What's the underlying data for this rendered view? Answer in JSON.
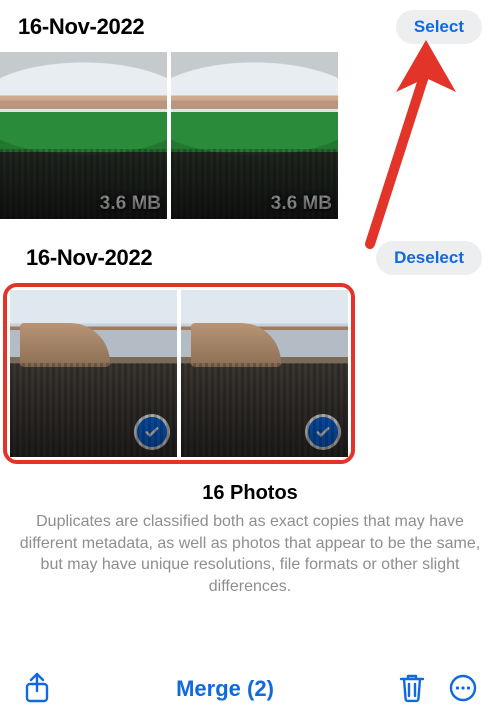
{
  "groups": [
    {
      "date": "16-Nov-2022",
      "action_label": "Select",
      "selected": false,
      "photos": [
        {
          "size": "3.6 MB",
          "selected": false
        },
        {
          "size": "3.6 MB",
          "selected": false
        }
      ]
    },
    {
      "date": "16-Nov-2022",
      "action_label": "Deselect",
      "selected": true,
      "photos": [
        {
          "size": "",
          "selected": true
        },
        {
          "size": "",
          "selected": true
        }
      ]
    }
  ],
  "summary": {
    "title": "16 Photos",
    "body": "Duplicates are classified both as exact copies that may have different metadata, as well as photos that appear to be the same, but may have unique resolutions, file formats or other slight differences."
  },
  "toolbar": {
    "merge_label": "Merge (2)"
  },
  "colors": {
    "accent": "#1169e0",
    "annotation": "#e33429"
  }
}
